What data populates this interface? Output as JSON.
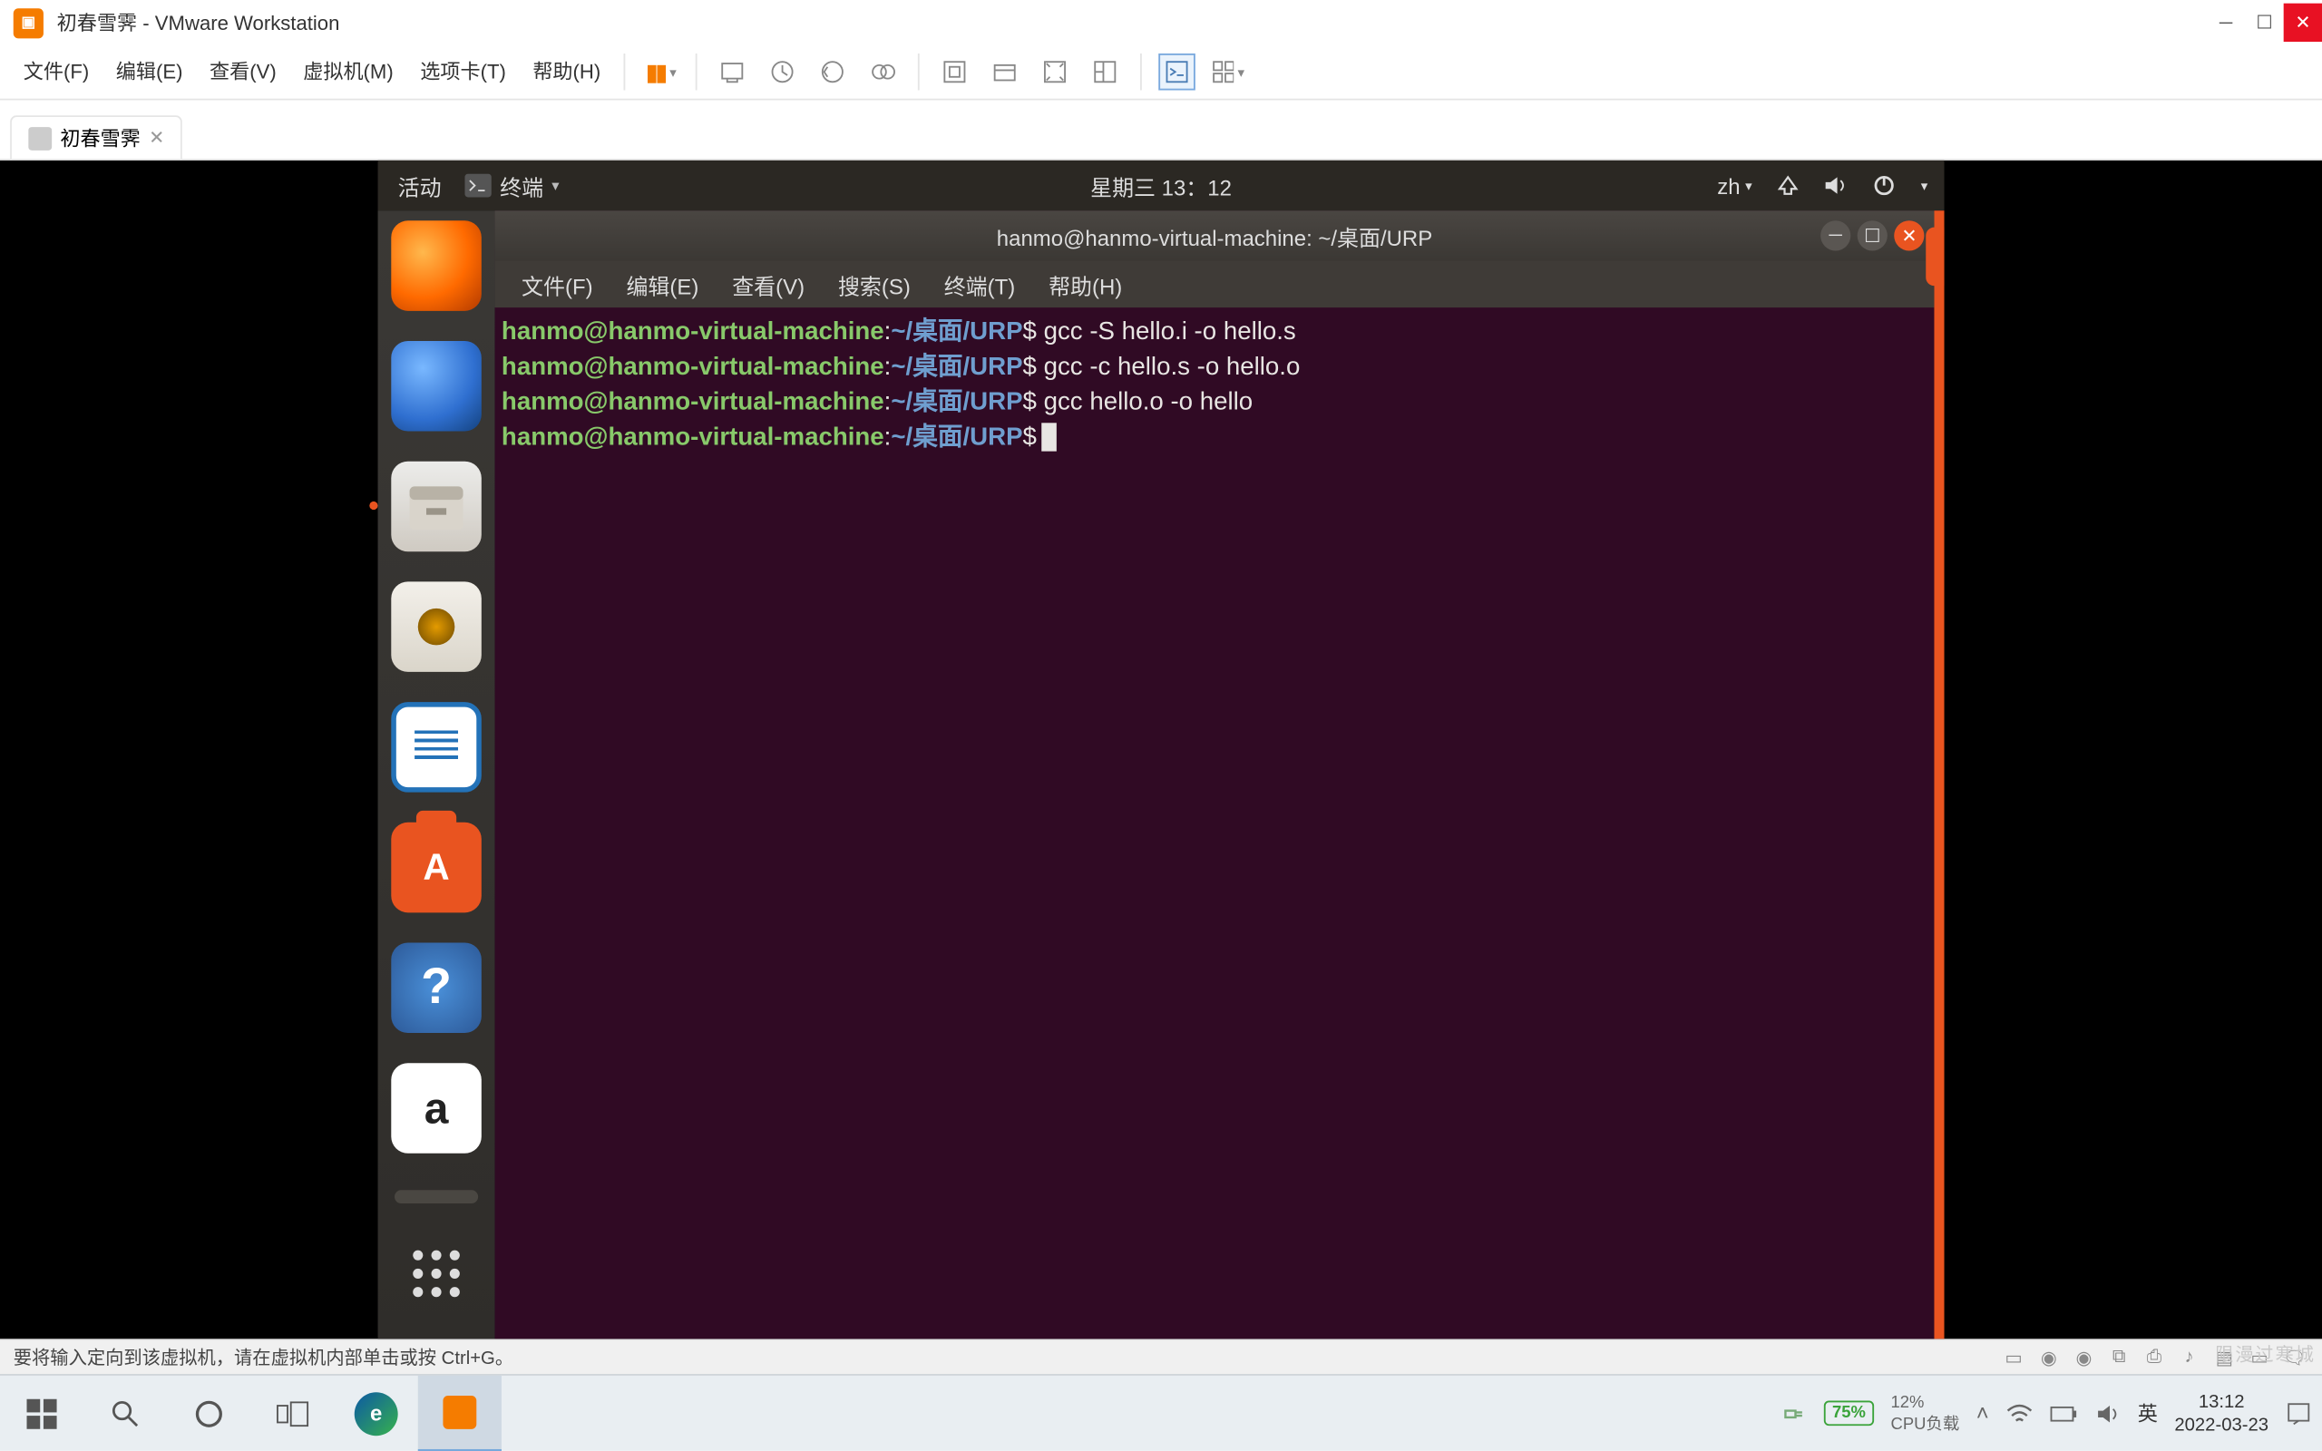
{
  "vmware": {
    "window_title": "初春雪霁 - VMware Workstation",
    "menu": {
      "file": "文件(F)",
      "edit": "编辑(E)",
      "view": "查看(V)",
      "vm": "虚拟机(M)",
      "tabs_m": "选项卡(T)",
      "help": "帮助(H)"
    },
    "tab_label": "初春雪霁",
    "status_hint": "要将输入定向到该虚拟机，请在虚拟机内部单击或按 Ctrl+G。"
  },
  "ubuntu": {
    "activities": "活动",
    "terminal_btn": "终端",
    "date_time": "星期三 13：12",
    "lang": "zh",
    "terminal": {
      "title": "hanmo@hanmo-virtual-machine: ~/桌面/URP",
      "menu": {
        "file": "文件(F)",
        "edit": "编辑(E)",
        "view": "查看(V)",
        "search": "搜索(S)",
        "terminal": "终端(T)",
        "help": "帮助(H)"
      },
      "prompt_user": "hanmo@hanmo-virtual-machine",
      "prompt_path": "~/桌面/URP",
      "lines": [
        "gcc -S hello.i -o hello.s",
        "gcc -c hello.s -o hello.o",
        "gcc hello.o -o hello"
      ]
    }
  },
  "windows": {
    "battery_pct": "75%",
    "cpu_pct": "12%",
    "cpu_label": "CPU负载",
    "ime": "英",
    "time": "13:12",
    "date": "2022-03-23"
  },
  "watermark": "限漫过寒城"
}
